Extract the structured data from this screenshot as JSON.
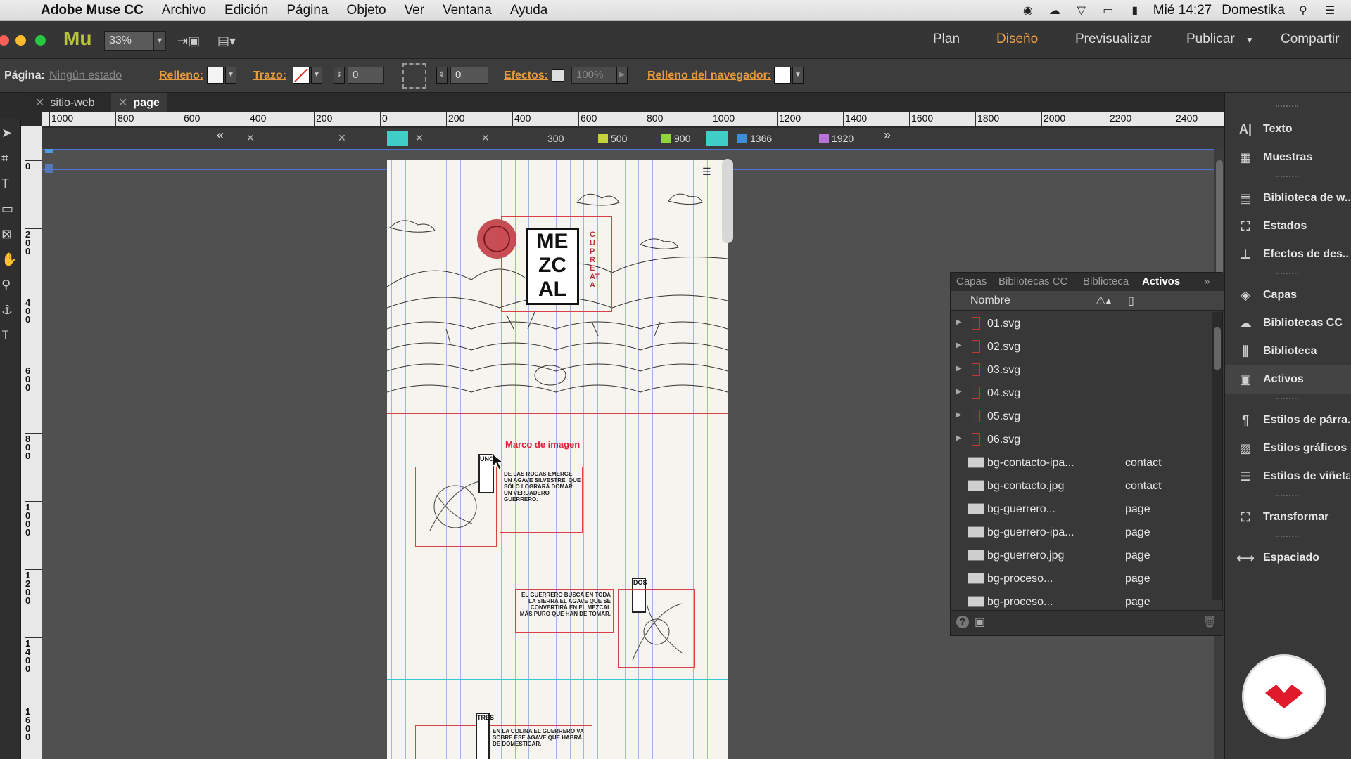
{
  "menubar": {
    "app_name": "Adobe Muse CC",
    "items": [
      "Archivo",
      "Edición",
      "Página",
      "Objeto",
      "Ver",
      "Ventana",
      "Ayuda"
    ],
    "clock": "Mié 14:27",
    "user": "Domestika"
  },
  "app_toolbar": {
    "logo": "Mu",
    "zoom": "33%",
    "modes": [
      "Plan",
      "Diseño",
      "Previsualizar",
      "Publicar",
      "Compartir"
    ],
    "active_mode": "Diseño"
  },
  "control_bar": {
    "page_label": "Página:",
    "page_state": "Ningún estado",
    "fill_label": "Relleno:",
    "stroke_label": "Trazo:",
    "stroke_value": "0",
    "corner_value": "0",
    "effects_label": "Efectos:",
    "effects_value": "100%",
    "browser_fill_label": "Relleno del navegador:"
  },
  "tabs": [
    "sitio-web",
    "page"
  ],
  "hruler_ticks": [
    "1000",
    "800",
    "600",
    "400",
    "200",
    "0",
    "200",
    "400",
    "600",
    "800",
    "1000",
    "1200",
    "1400",
    "1600",
    "1800",
    "2000",
    "2200",
    "2400"
  ],
  "vruler_ticks": [
    "0",
    "2\n0\n0",
    "4\n0\n0",
    "6\n0\n0",
    "8\n0\n0",
    "1\n0\n0\n0",
    "1\n2\n0\n0",
    "1\n4\n0\n0",
    "1\n6\n0\n0"
  ],
  "breakpoints": {
    "labels": [
      "300",
      "500",
      "900",
      "1366",
      "1920"
    ],
    "colors": [
      "",
      "#c3d13c",
      "#8fd43a",
      "#3c8edb",
      "#b774d6"
    ]
  },
  "page_content": {
    "logo_lines": [
      "ME",
      "ZC",
      "AL"
    ],
    "side_text": "CUPREATA",
    "image_frame_label": "Marco de imagen",
    "uno_label": "UNO",
    "dos_label": "DOS",
    "tres_label": "TRES",
    "text_1": "De las rocas emerge un agave silvestre, que sólo logrará domar un verdadero guerrero.",
    "text_2": "El guerrero busca en toda la sierra el agave que se convertirá en el mezcal más puro que han de tomar.",
    "text_3": "En la colina el guerrero va sobre ese agave que habrá de domesticar."
  },
  "assets_panel": {
    "tabs": [
      "Capas",
      "Bibliotecas CC",
      "Biblioteca",
      "Activos"
    ],
    "active_tab": "Activos",
    "column_name": "Nombre",
    "rows": [
      {
        "name": "01.svg",
        "page": "",
        "type": "folder"
      },
      {
        "name": "02.svg",
        "page": "",
        "type": "folder"
      },
      {
        "name": "03.svg",
        "page": "",
        "type": "folder"
      },
      {
        "name": "04.svg",
        "page": "",
        "type": "folder"
      },
      {
        "name": "05.svg",
        "page": "",
        "type": "folder"
      },
      {
        "name": "06.svg",
        "page": "",
        "type": "folder"
      },
      {
        "name": "bg-contacto-ipa...",
        "page": "contact",
        "type": "image"
      },
      {
        "name": "bg-contacto.jpg",
        "page": "contact",
        "type": "image"
      },
      {
        "name": "bg-guerrero...",
        "page": "page",
        "type": "image"
      },
      {
        "name": "bg-guerrero-ipa...",
        "page": "page",
        "type": "image"
      },
      {
        "name": "bg-guerrero.jpg",
        "page": "page",
        "type": "image"
      },
      {
        "name": "bg-proceso...",
        "page": "page",
        "type": "image"
      },
      {
        "name": "bg-proceso...",
        "page": "page",
        "type": "image"
      }
    ]
  },
  "right_panel": {
    "items": [
      {
        "label": "Texto",
        "icon": "text-icon",
        "glyph": "A|"
      },
      {
        "label": "Muestras",
        "icon": "swatches-icon",
        "glyph": "▦"
      },
      {
        "label": "Biblioteca de w...",
        "icon": "widget-library-icon",
        "glyph": "▤"
      },
      {
        "label": "Estados",
        "icon": "states-icon",
        "glyph": "⛶"
      },
      {
        "label": "Efectos de des...",
        "icon": "scroll-effects-icon",
        "glyph": "⊥"
      },
      {
        "label": "Capas",
        "icon": "layers-icon",
        "glyph": "◈"
      },
      {
        "label": "Bibliotecas CC",
        "icon": "cc-libraries-icon",
        "glyph": "☁"
      },
      {
        "label": "Biblioteca",
        "icon": "library-icon",
        "glyph": "⫼"
      },
      {
        "label": "Activos",
        "icon": "assets-icon",
        "glyph": "▣"
      },
      {
        "label": "Estilos de párra...",
        "icon": "paragraph-styles-icon",
        "glyph": "¶"
      },
      {
        "label": "Estilos gráficos",
        "icon": "graphic-styles-icon",
        "glyph": "▨"
      },
      {
        "label": "Estilos de viñeta",
        "icon": "bullet-styles-icon",
        "glyph": "☰"
      },
      {
        "label": "Transformar",
        "icon": "transform-icon",
        "glyph": "⛶"
      },
      {
        "label": "Espaciado",
        "icon": "spacing-icon",
        "glyph": "⟷"
      }
    ]
  }
}
